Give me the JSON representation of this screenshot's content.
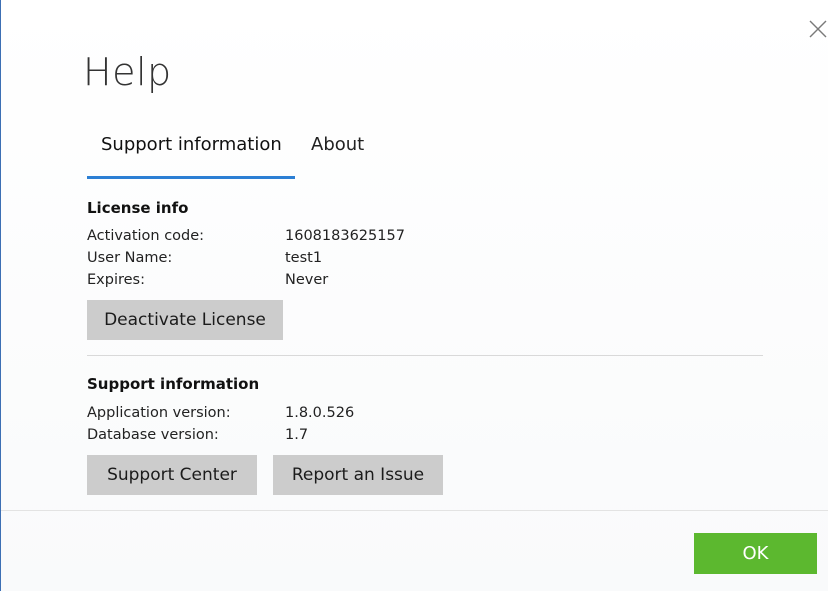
{
  "dialog": {
    "title": "Help",
    "close_icon": "close-icon"
  },
  "tabs": [
    {
      "label": "Support information",
      "active": true
    },
    {
      "label": "About",
      "active": false
    }
  ],
  "license": {
    "heading": "License info",
    "rows": [
      {
        "label": "Activation code:",
        "value": "1608183625157"
      },
      {
        "label": "User Name:",
        "value": "test1"
      },
      {
        "label": "Expires:",
        "value": "Never"
      }
    ],
    "deactivate_label": "Deactivate License"
  },
  "support": {
    "heading": "Support information",
    "rows": [
      {
        "label": "Application version:",
        "value": "1.8.0.526"
      },
      {
        "label": "Database version:",
        "value": "1.7"
      }
    ],
    "support_center_label": "Support Center",
    "report_issue_label": "Report an Issue"
  },
  "footer": {
    "ok_label": "OK"
  },
  "colors": {
    "accent": "#2b7fd4",
    "ok_button": "#5cb82f",
    "button_gray": "#cccccc"
  }
}
